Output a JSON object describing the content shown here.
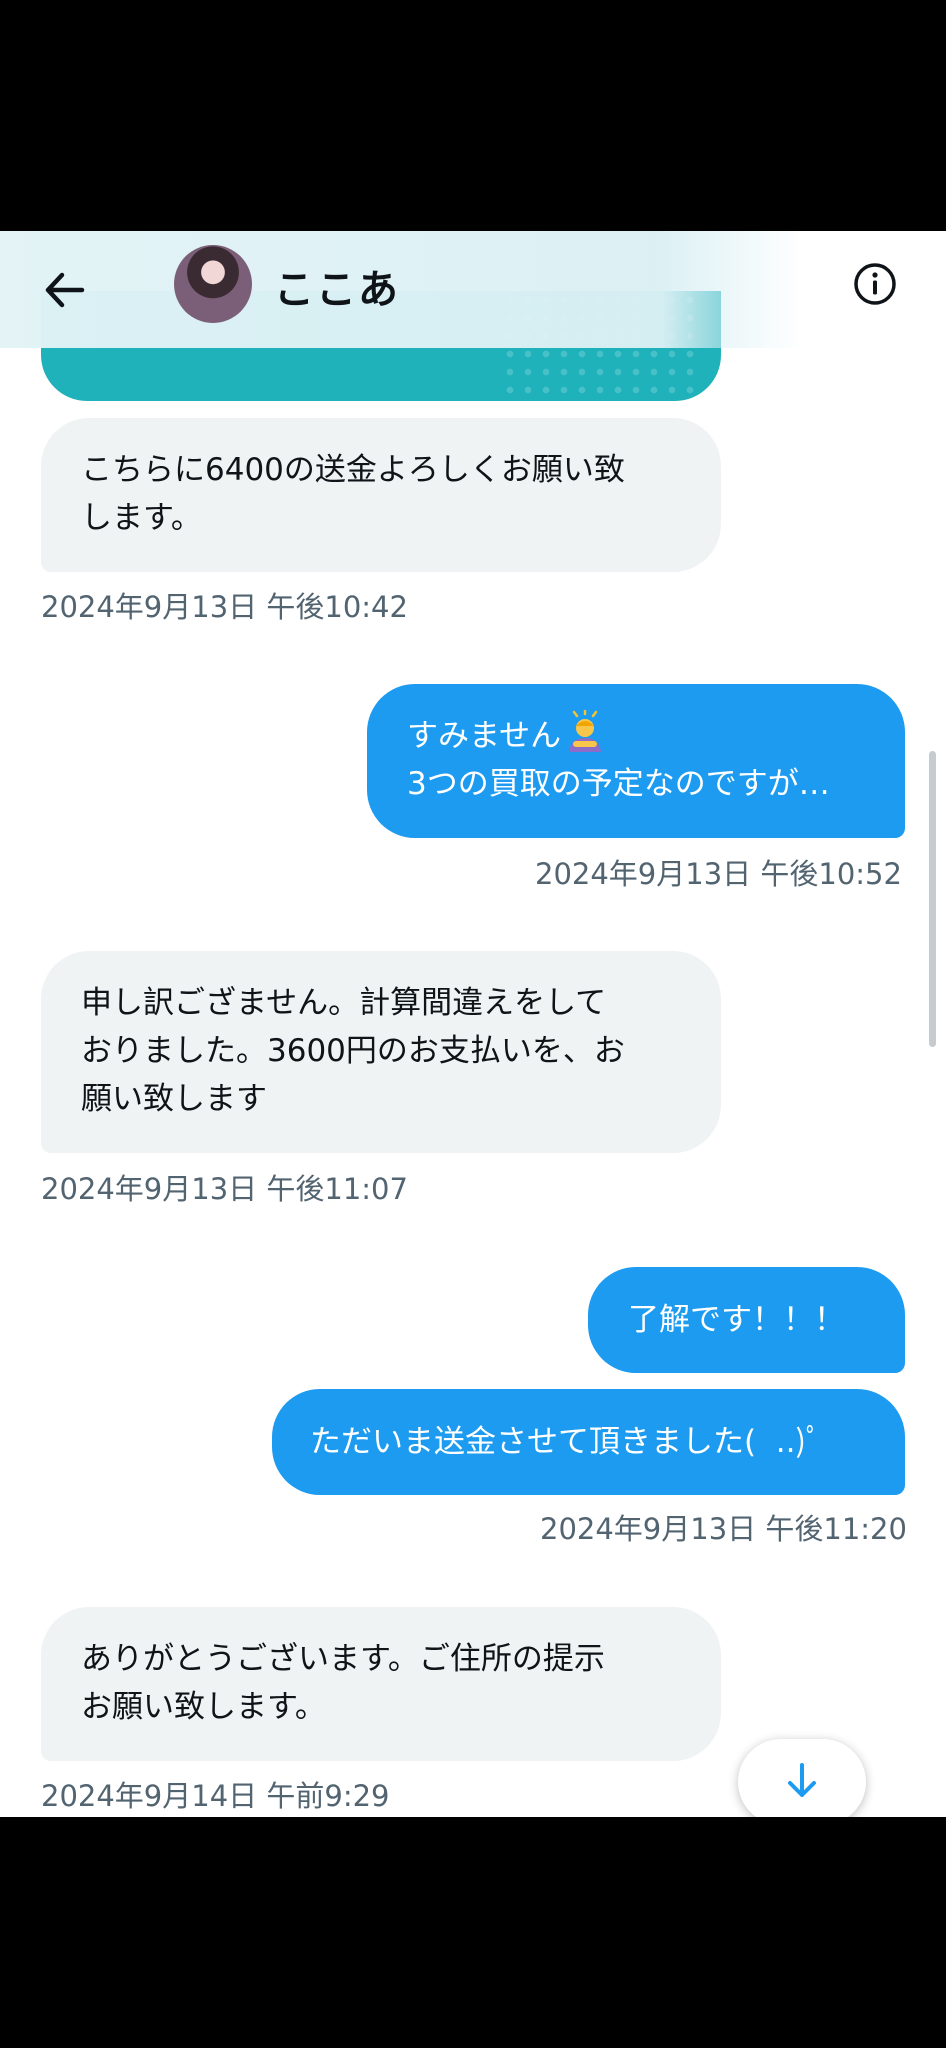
{
  "header": {
    "contact_name": "ここあ",
    "back_icon": "arrow-left-icon",
    "info_icon": "info-icon"
  },
  "messages": [
    {
      "direction": "incoming",
      "lines": [
        "こちらに6400の送金よろしくお願い致",
        "します。"
      ],
      "timestamp": "2024年9月13日 午後10:42"
    },
    {
      "direction": "outgoing",
      "lines": [
        "すみません",
        "3つの買取の予定なのですが…"
      ],
      "emoji": "person-bowing",
      "timestamp": "2024年9月13日 午後10:52"
    },
    {
      "direction": "incoming",
      "lines": [
        "申し訳ござません。計算間違えをして",
        "おりました。3600円のお支払いを、お",
        "願い致します"
      ],
      "timestamp": "2024年9月13日 午後11:07"
    },
    {
      "direction": "outgoing",
      "lines": [
        "了解です！！！"
      ]
    },
    {
      "direction": "outgoing",
      "lines": [
        "ただいま送金させて頂きました(  ..)ﾟ"
      ],
      "timestamp": "2024年9月13日 午後11:20"
    },
    {
      "direction": "incoming",
      "lines": [
        "ありがとうございます。ご住所の提示",
        "お願い致します。"
      ],
      "timestamp": "2024年9月14日 午前9:29"
    }
  ],
  "colors": {
    "outgoing_bubble": "#1d9bf0",
    "incoming_bubble": "#eff3f4",
    "timestamp_text": "#536471",
    "card_teal": "#20b2bb"
  }
}
